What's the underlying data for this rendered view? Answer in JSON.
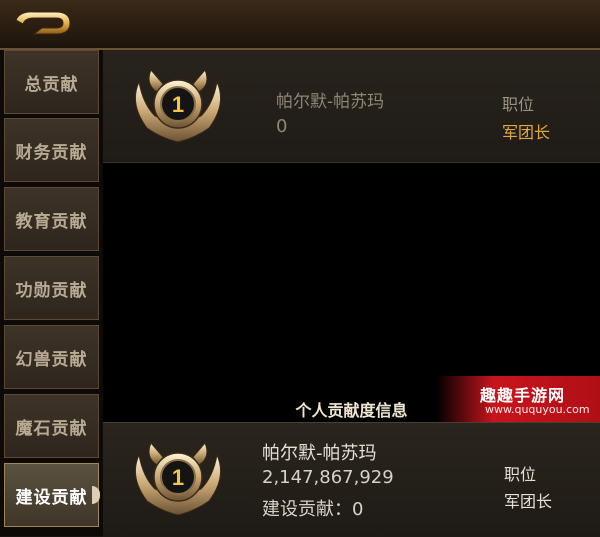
{
  "sidebar": {
    "items": [
      {
        "label": "总贡献"
      },
      {
        "label": "财务贡献"
      },
      {
        "label": "教育贡献"
      },
      {
        "label": "功勋贡献"
      },
      {
        "label": "幻兽贡献"
      },
      {
        "label": "魔石贡献"
      },
      {
        "label": "建设贡献"
      }
    ],
    "active_index": 6
  },
  "ranking": [
    {
      "rank": "1",
      "name": "帕尔默-帕苏玛",
      "score": "0",
      "position_label": "职位",
      "position": "军团长"
    }
  ],
  "personal": {
    "title": "个人贡献度信息",
    "rank": "1",
    "name": "帕尔默-帕苏玛",
    "total": "2,147,867,929",
    "build_contribution": "建设贡献：0",
    "position_label": "职位",
    "position": "军团长"
  },
  "watermark": {
    "title": "趣趣手游网",
    "url": "www.ququyou.com"
  },
  "colors": {
    "accent_gold": "#e3a73e",
    "active_tab": "#5c5240"
  },
  "icons": {
    "back": "back-arrow-icon",
    "badge": "rank-badge-icon"
  }
}
